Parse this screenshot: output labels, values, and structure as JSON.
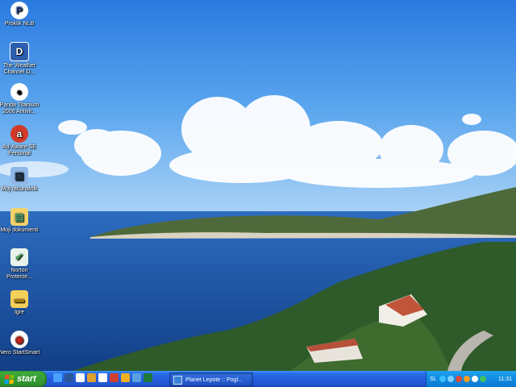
{
  "desktop": {
    "icons": [
      {
        "label": "Proklik NLB",
        "icon": "proklik-icon",
        "color": "#1f3d8f"
      },
      {
        "label": "The Weather Channel D...",
        "icon": "weather-icon",
        "color": "#2d5fb0"
      },
      {
        "label": "Panda Titanium 2006 Antivir...",
        "icon": "panda-icon",
        "color": "#ffffff"
      },
      {
        "label": "Ad-Aware SE Personal",
        "icon": "adaware-icon",
        "color": "#d23a2a"
      },
      {
        "label": "Moj računalnik",
        "icon": "computer-icon",
        "color": "#8fb8e8"
      },
      {
        "label": "Moji dokumenti",
        "icon": "documents-folder-icon",
        "color": "#f2d26a"
      },
      {
        "label": "Norton Protecte...",
        "icon": "norton-icon",
        "color": "#3a9a4a"
      },
      {
        "label": "Igre",
        "icon": "folder-icon",
        "color": "#f4d05a"
      },
      {
        "label": "Nero StartSmart",
        "icon": "nero-icon",
        "color": "#c8281e"
      }
    ]
  },
  "taskbar": {
    "start_label": "start",
    "quick_launch": [
      "ie-icon",
      "word-icon",
      "media-icon",
      "app-icon",
      "yahoo-icon",
      "app-icon",
      "app-icon",
      "app-icon",
      "excel-icon"
    ],
    "window_title": "Planet Lepote :: Pogl...",
    "tray": {
      "language": "SL",
      "clock": "11:31"
    }
  }
}
